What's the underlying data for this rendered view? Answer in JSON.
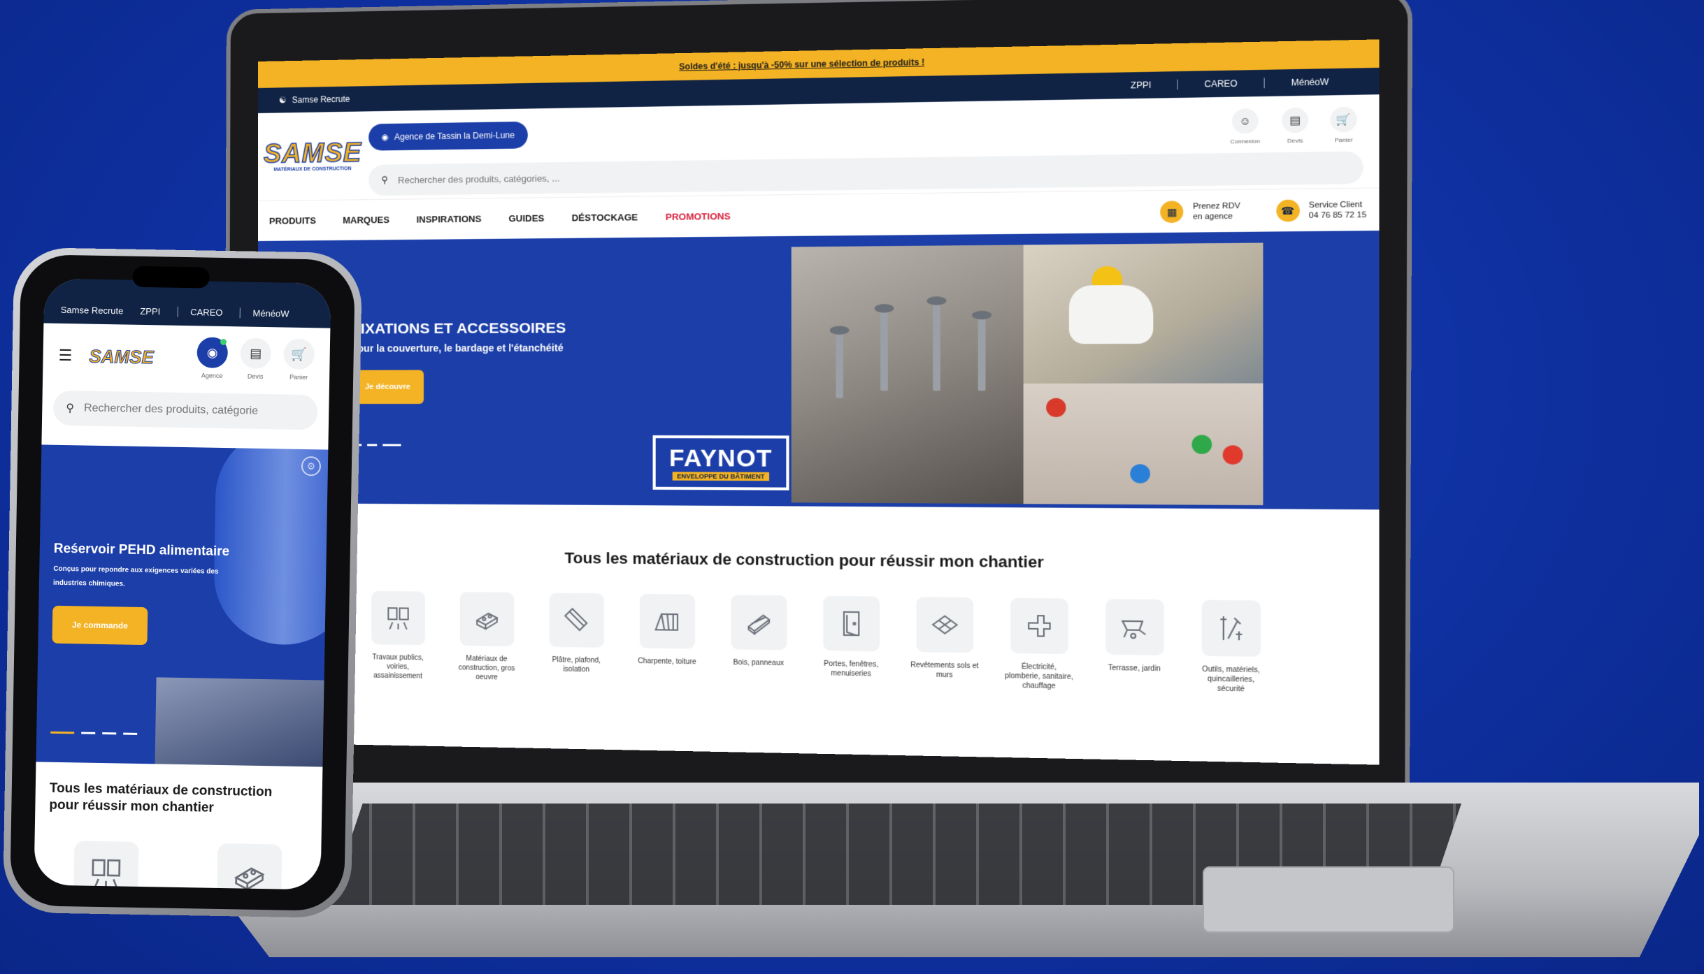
{
  "desktop": {
    "promo_banner": "Soldes d'été : jusqu'à -50% sur une sélection de produits !",
    "utility": {
      "recruit": "Samse Recrute",
      "brands": [
        "ZPPI",
        "CAREO",
        "MénéoW"
      ]
    },
    "logo": {
      "name": "SAMSE",
      "tagline": "MATÉRIAUX DE CONSTRUCTION"
    },
    "agency_label": "Agence de Tassin la Demi-Lune",
    "search_placeholder": "Rechercher des produits, catégories, ...",
    "header_icons": [
      "Connexion",
      "Devis",
      "Panier"
    ],
    "nav": [
      "PRODUITS",
      "MARQUES",
      "INSPIRATIONS",
      "GUIDES",
      "DÉSTOCKAGE",
      "PROMOTIONS"
    ],
    "rdv": {
      "line1": "Prenez RDV",
      "line2": "en agence"
    },
    "service": {
      "line1": "Service Client",
      "line2": "04 76 85 72 15"
    },
    "hero": {
      "title": "FIXATIONS ET ACCESSOIRES",
      "subtitle": "pour la couverture, le bardage et l'étanchéité",
      "cta": "Je découvre",
      "brand_name": "FAYNOT",
      "brand_tagline": "ENVELOPPE DU BÂTIMENT"
    },
    "section_title": "Tous les matériaux de construction pour réussir mon chantier",
    "categories": [
      "Travaux publics, voiries, assainissement",
      "Matériaux de construction, gros oeuvre",
      "Plâtre, plafond, isolation",
      "Charpente, toiture",
      "Bois, panneaux",
      "Portes, fenêtres, menuiseries",
      "Revêtements sols et murs",
      "Électricité, plomberie, sanitaire, chauffage",
      "Terrasse, jardin",
      "Outils, matériels, quincailleries, sécurité"
    ]
  },
  "mobile": {
    "utility": {
      "recruit": "Samse Recrute",
      "brands": [
        "ZPPI",
        "CAREO",
        "MénéoW"
      ]
    },
    "logo": "SAMSE",
    "icons": [
      "Agence",
      "Devis",
      "Panier"
    ],
    "search_placeholder": "Rechercher des produits, catégorie",
    "hero": {
      "title": "Reśervoir PEHD alimentaire",
      "subtitle": "Conçus pour repondre aux exigences variées des industries chimiques.",
      "cta": "Je commande"
    },
    "section_title": "Tous les matériaux de construction pour réussir mon chantier"
  },
  "colors": {
    "accent": "#f4b324",
    "brand_blue": "#1b3ea8",
    "navy": "#102345",
    "promo_red": "#d81e3a"
  }
}
